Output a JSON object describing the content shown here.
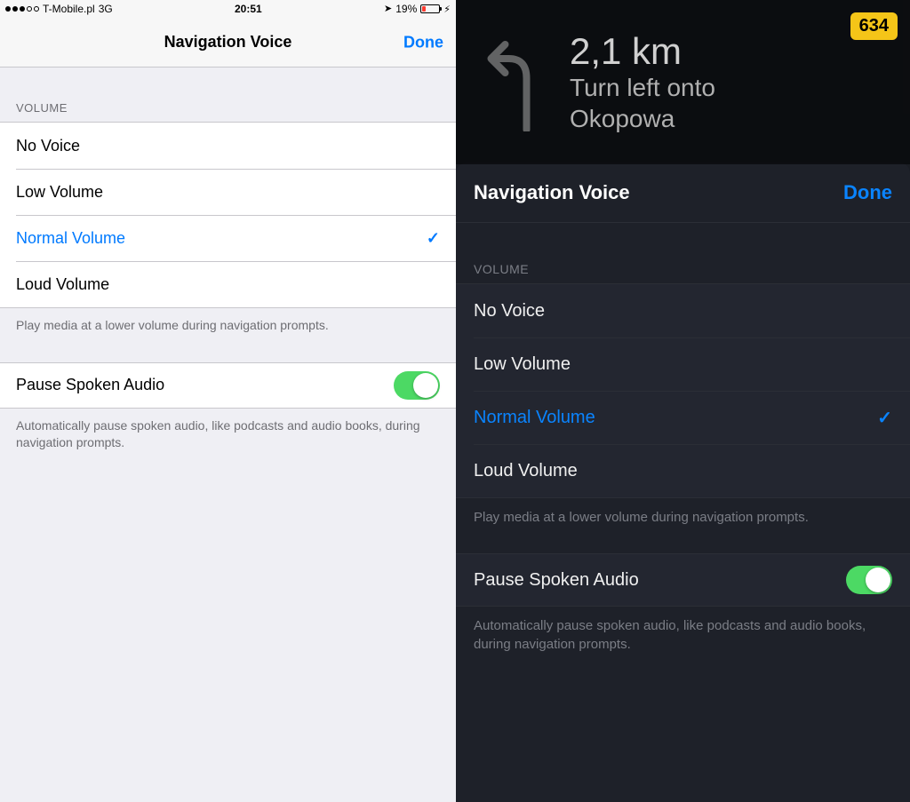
{
  "left": {
    "status": {
      "carrier": "T-Mobile.pl",
      "network": "3G",
      "time": "20:51",
      "battery_pct": "19%"
    },
    "nav": {
      "title": "Navigation Voice",
      "done": "Done"
    },
    "section": {
      "header": "VOLUME",
      "options": [
        "No Voice",
        "Low Volume",
        "Normal Volume",
        "Loud Volume"
      ],
      "selected_index": 2,
      "footer": "Play media at a lower volume during navigation prompts."
    },
    "pause": {
      "label": "Pause Spoken Audio",
      "on": true,
      "footer": "Automatically pause spoken audio, like podcasts and audio books, during navigation prompts."
    }
  },
  "right": {
    "turn": {
      "distance": "2,1 km",
      "instruction_line1": "Turn left onto",
      "instruction_line2": "Okopowa",
      "route_badge": "634"
    },
    "sheet": {
      "title": "Navigation Voice",
      "done": "Done"
    },
    "section": {
      "header": "VOLUME",
      "options": [
        "No Voice",
        "Low Volume",
        "Normal Volume",
        "Loud Volume"
      ],
      "selected_index": 2,
      "footer": "Play media at a lower volume during navigation prompts."
    },
    "pause": {
      "label": "Pause Spoken Audio",
      "on": true,
      "footer": "Automatically pause spoken audio, like podcasts and audio books, during navigation prompts."
    }
  }
}
